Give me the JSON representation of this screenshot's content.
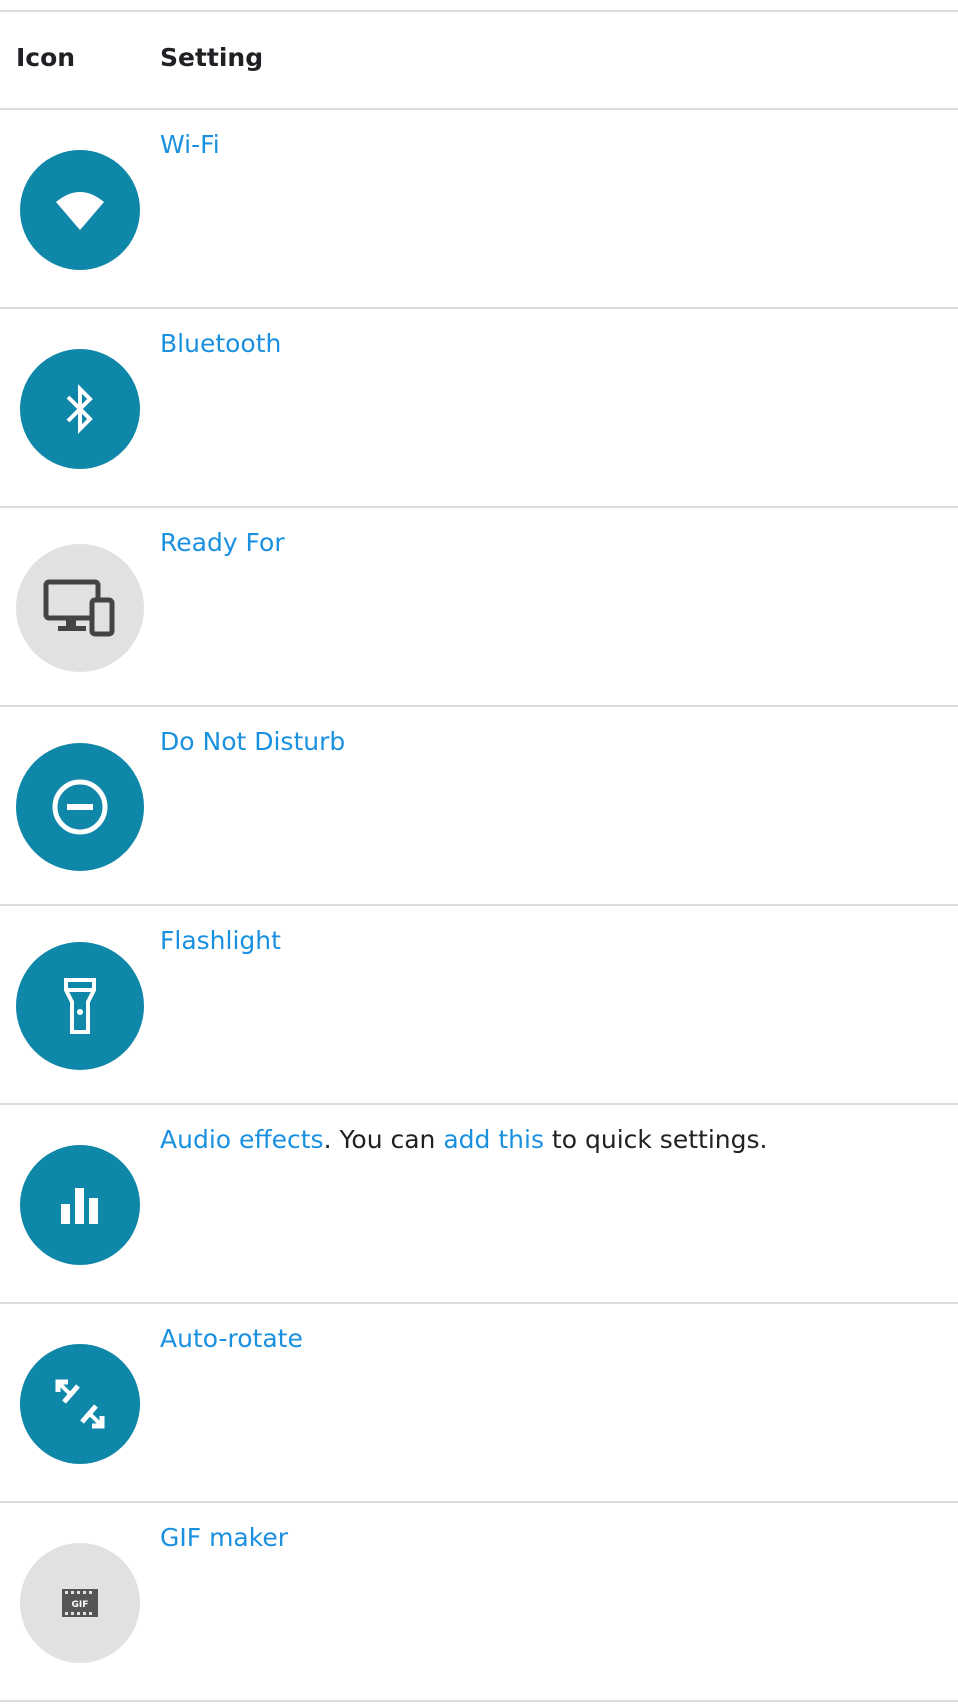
{
  "header": {
    "icon_col": "Icon",
    "setting_col": "Setting"
  },
  "rows": [
    {
      "label": "Wi-Fi",
      "icon": "wifi-icon",
      "color": "#0f87a8"
    },
    {
      "label": "Bluetooth",
      "icon": "bluetooth-icon",
      "color": "#0f87a8"
    },
    {
      "label": "Ready For",
      "icon": "ready-for-icon",
      "color": "#e1e1e1"
    },
    {
      "label": "Do Not Disturb",
      "icon": "do-not-disturb-icon",
      "color": "#0f87a8"
    },
    {
      "label": "Flashlight",
      "icon": "flashlight-icon",
      "color": "#0f87a8"
    },
    {
      "label": "Audio effects",
      "text_mid": ". You can ",
      "link2": "add this",
      "text_end": " to quick settings.",
      "icon": "audio-effects-icon",
      "color": "#0f87a8"
    },
    {
      "label": "Auto-rotate",
      "icon": "auto-rotate-icon",
      "color": "#0f87a8"
    },
    {
      "label": "GIF maker",
      "icon": "gif-maker-icon",
      "color": "#e1e1e1"
    }
  ],
  "gif_icon_text": "GIF",
  "colors": {
    "link": "#1a90e0",
    "icon_blue": "#0f87a8",
    "icon_grey": "#e1e1e1",
    "divider": "#dadce0"
  }
}
